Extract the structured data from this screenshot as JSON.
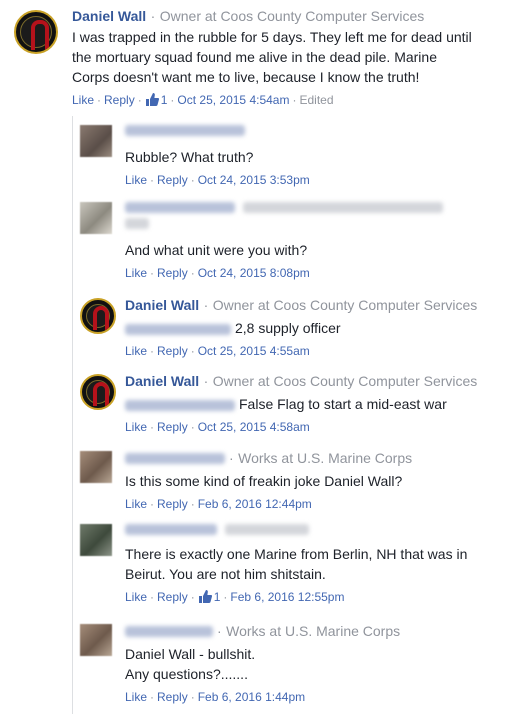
{
  "top_comment": {
    "author": "Daniel Wall",
    "sep": "·",
    "subtitle": "Owner at Coos County Computer Services",
    "text_lines": [
      "I was trapped in the rubble for 5 days. They left me for dead until",
      "the mortuary squad found me alive in the dead pile. Marine",
      "Corps doesn't want me to live, because I know the truth!"
    ],
    "like_label": "Like",
    "reply_label": "Reply",
    "like_count": "1",
    "timestamp": "Oct 25, 2015 4:54am",
    "edited_label": "Edited"
  },
  "replies": [
    {
      "text_lines": [
        "Rubble? What truth?"
      ],
      "like_label": "Like",
      "reply_label": "Reply",
      "timestamp": "Oct 24, 2015 3:53pm"
    },
    {
      "text_lines": [
        "And what unit were you with?"
      ],
      "like_label": "Like",
      "reply_label": "Reply",
      "timestamp": "Oct 24, 2015 8:08pm"
    },
    {
      "author": "Daniel Wall",
      "subtitle": "Owner at Coos County Computer Services",
      "text_lines": [
        "2,8 supply officer"
      ],
      "like_label": "Like",
      "reply_label": "Reply",
      "timestamp": "Oct 25, 2015 4:55am"
    },
    {
      "author": "Daniel Wall",
      "subtitle": "Owner at Coos County Computer Services",
      "text_lines": [
        "False Flag to start a mid-east war"
      ],
      "like_label": "Like",
      "reply_label": "Reply",
      "timestamp": "Oct 25, 2015 4:58am"
    },
    {
      "subtitle": "Works at U.S. Marine Corps",
      "text_lines": [
        "Is this some kind of freakin joke Daniel Wall?"
      ],
      "like_label": "Like",
      "reply_label": "Reply",
      "timestamp": "Feb 6, 2016 12:44pm"
    },
    {
      "text_lines": [
        "There is exactly one Marine from Berlin, NH that was in",
        "Beirut. You are not him shitstain."
      ],
      "like_label": "Like",
      "reply_label": "Reply",
      "like_count": "1",
      "timestamp": "Feb 6, 2016 12:55pm"
    },
    {
      "subtitle": "Works at U.S. Marine Corps",
      "text_lines": [
        "Daniel Wall - bullshit.",
        "Any questions?......."
      ],
      "like_label": "Like",
      "reply_label": "Reply",
      "timestamp": "Feb 6, 2016 1:44pm"
    }
  ],
  "colors": {
    "link": "#4267b2",
    "name": "#365899",
    "meta": "#90949c",
    "text": "#1d2129"
  },
  "icons": {
    "like": "thumbs-up-icon",
    "seal": "marine-seal-avatar"
  }
}
